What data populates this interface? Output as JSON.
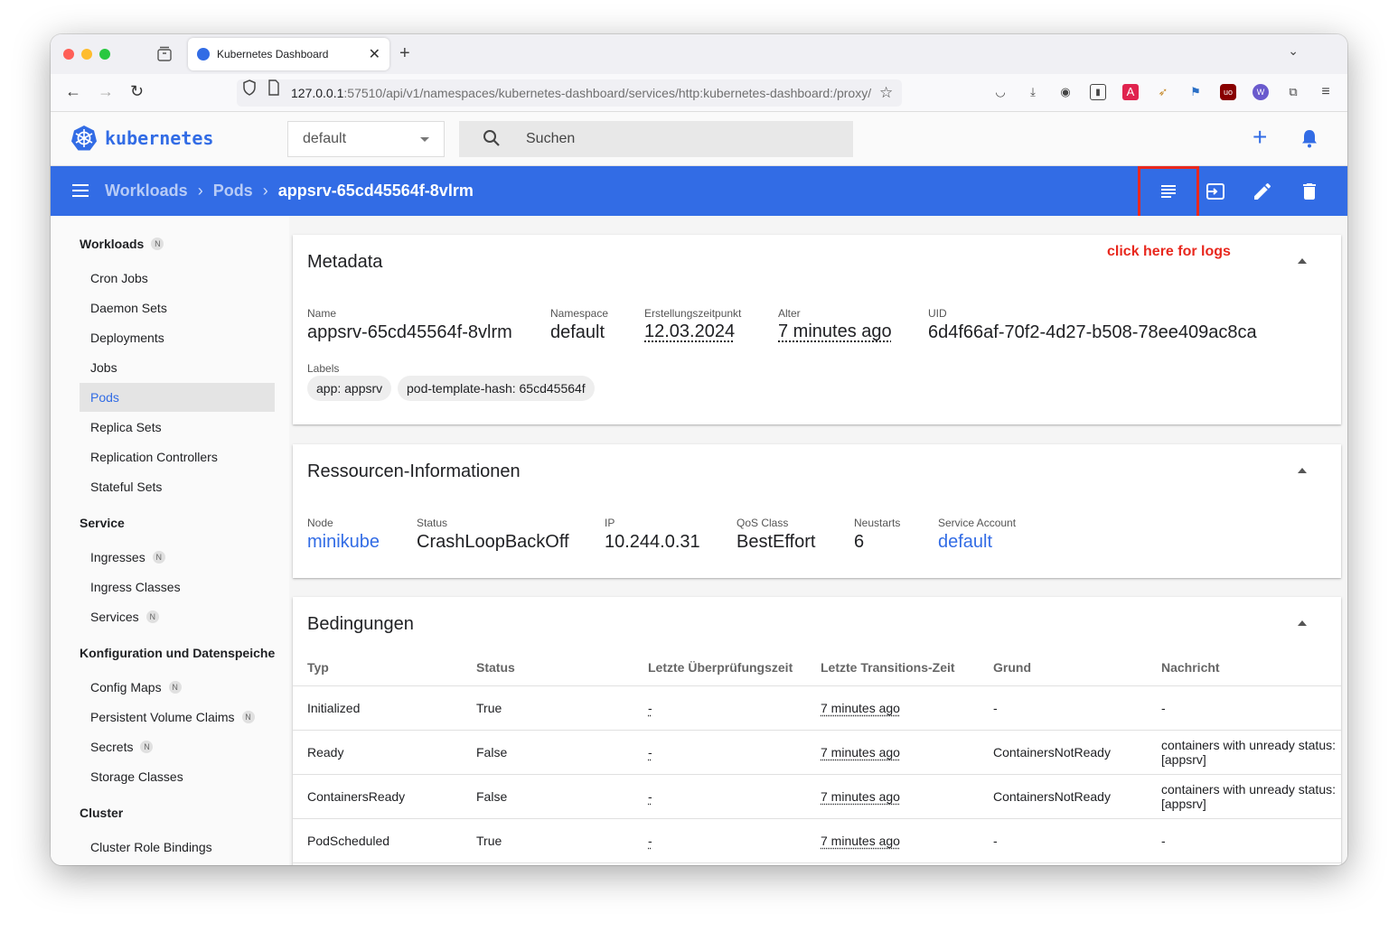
{
  "browser": {
    "tab_title": "Kubernetes Dashboard",
    "url_host": "127.0.0.1",
    "url_rest": ":57510/api/v1/namespaces/kubernetes-dashboard/services/http:kubernetes-dashboard:/proxy/"
  },
  "app": {
    "logo_text": "kubernetes",
    "namespace": "default",
    "search_placeholder": "Suchen"
  },
  "breadcrumb": {
    "items": [
      "Workloads",
      "Pods"
    ],
    "current": "appsrv-65cd45564f-8vlrm"
  },
  "annotation": "click here for logs",
  "sidebar": {
    "workloads_header": "Workloads",
    "workloads_badge": "N",
    "workloads": [
      "Cron Jobs",
      "Daemon Sets",
      "Deployments",
      "Jobs",
      "Pods",
      "Replica Sets",
      "Replication Controllers",
      "Stateful Sets"
    ],
    "service_header": "Service",
    "service": [
      {
        "label": "Ingresses",
        "badge": "N"
      },
      {
        "label": "Ingress Classes",
        "badge": ""
      },
      {
        "label": "Services",
        "badge": "N"
      }
    ],
    "config_header": "Konfiguration und Datenspeicherung",
    "config": [
      {
        "label": "Config Maps",
        "badge": "N"
      },
      {
        "label": "Persistent Volume Claims",
        "badge": "N"
      },
      {
        "label": "Secrets",
        "badge": "N"
      },
      {
        "label": "Storage Classes",
        "badge": ""
      }
    ],
    "cluster_header": "Cluster",
    "cluster": [
      "Cluster Role Bindings"
    ]
  },
  "metadata": {
    "title": "Metadata",
    "name_label": "Name",
    "name": "appsrv-65cd45564f-8vlrm",
    "namespace_label": "Namespace",
    "namespace": "default",
    "created_label": "Erstellungszeitpunkt",
    "created": "12.03.2024",
    "age_label": "Alter",
    "age": "7 minutes ago",
    "uid_label": "UID",
    "uid": "6d4f66af-70f2-4d27-b508-78ee409ac8ca",
    "labels_label": "Labels",
    "labels": [
      "app: appsrv",
      "pod-template-hash: 65cd45564f"
    ]
  },
  "resources": {
    "title": "Ressourcen-Informationen",
    "node_label": "Node",
    "node": "minikube",
    "status_label": "Status",
    "status": "CrashLoopBackOff",
    "ip_label": "IP",
    "ip": "10.244.0.31",
    "qos_label": "QoS Class",
    "qos": "BestEffort",
    "restarts_label": "Neustarts",
    "restarts": "6",
    "sa_label": "Service Account",
    "sa": "default"
  },
  "conditions": {
    "title": "Bedingungen",
    "headers": [
      "Typ",
      "Status",
      "Letzte Überprüfungszeit",
      "Letzte Transitions-Zeit",
      "Grund",
      "Nachricht"
    ],
    "rows": [
      [
        "Initialized",
        "True",
        "-",
        "7 minutes ago",
        "-",
        "-"
      ],
      [
        "Ready",
        "False",
        "-",
        "7 minutes ago",
        "ContainersNotReady",
        "containers with unready status: [appsrv]"
      ],
      [
        "ContainersReady",
        "False",
        "-",
        "7 minutes ago",
        "ContainersNotReady",
        "containers with unready status: [appsrv]"
      ],
      [
        "PodScheduled",
        "True",
        "-",
        "7 minutes ago",
        "-",
        "-"
      ]
    ]
  }
}
